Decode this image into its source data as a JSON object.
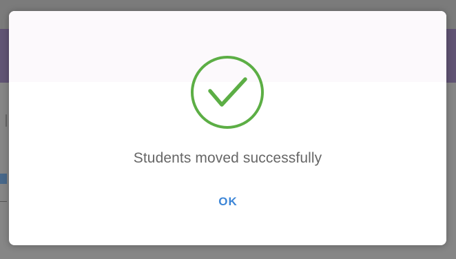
{
  "dialog": {
    "message": "Students moved successfully",
    "ok_label": "OK",
    "icon": "check-circle-icon"
  },
  "colors": {
    "success": "#5cae45",
    "button": "#3d86d7",
    "message_text": "#666666",
    "background_header": "#5e4f73"
  }
}
